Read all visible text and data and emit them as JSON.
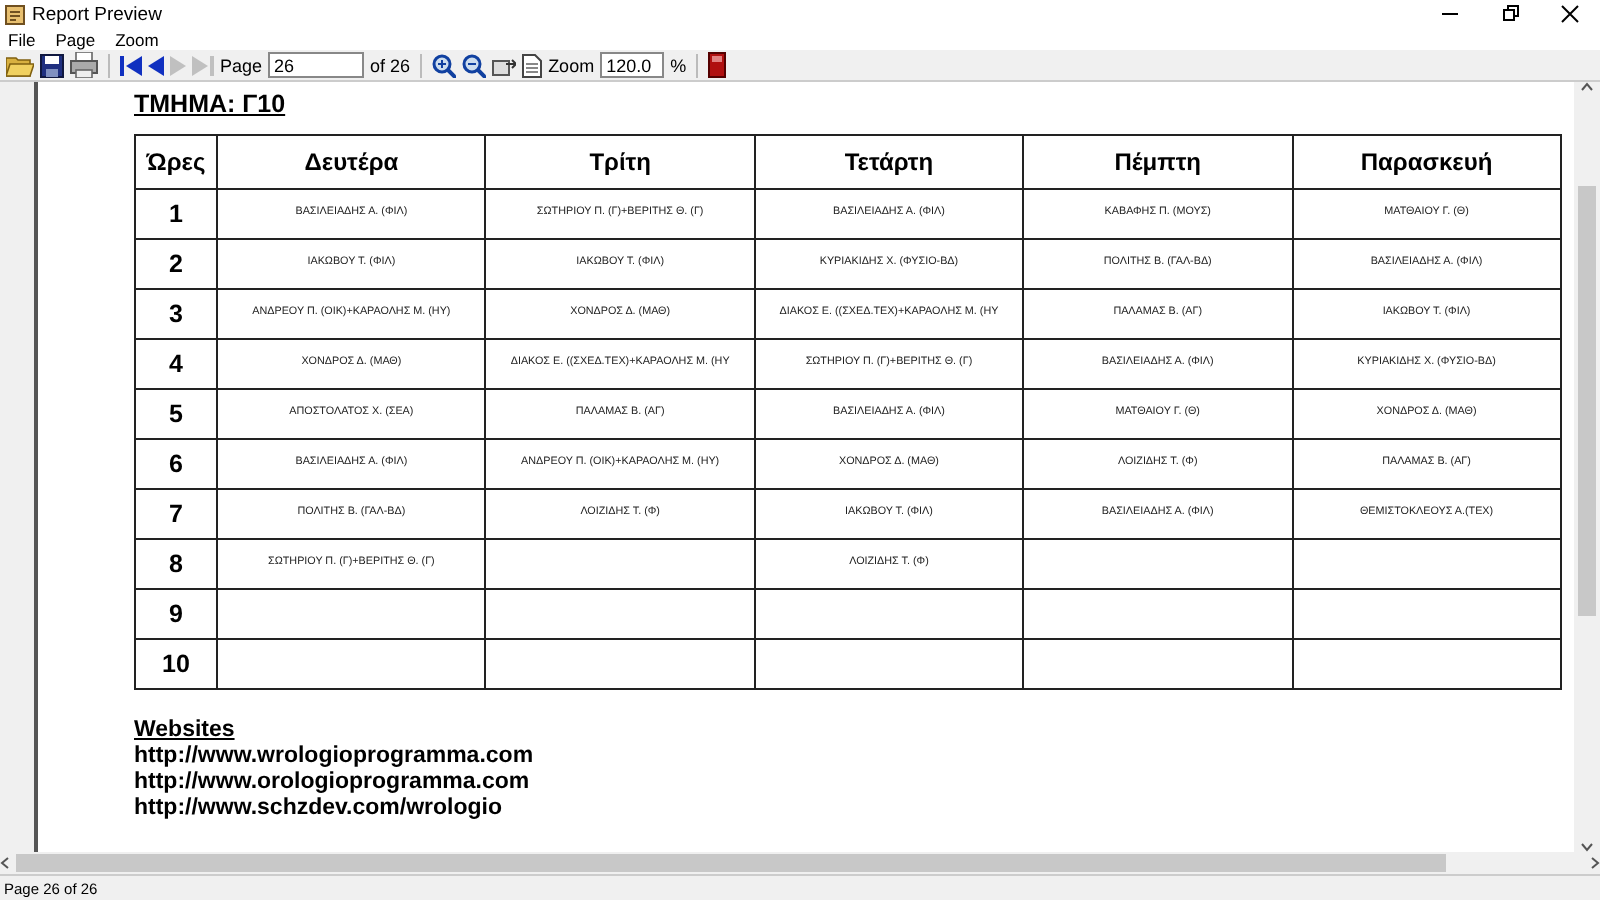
{
  "window": {
    "title": "Report Preview"
  },
  "menu": [
    "File",
    "Page",
    "Zoom"
  ],
  "toolbar": {
    "buttons": [
      {
        "kind": "open",
        "disabled": false
      },
      {
        "kind": "save",
        "disabled": false
      },
      {
        "kind": "print",
        "disabled": false
      },
      {
        "kind": "first",
        "disabled": false
      },
      {
        "kind": "prev",
        "disabled": false
      },
      {
        "kind": "next",
        "disabled": true
      },
      {
        "kind": "last",
        "disabled": true
      }
    ],
    "page_label": "Page",
    "page_value": "26",
    "page_of": "of 26",
    "zoom_buttons": [
      {
        "kind": "zoom_in"
      },
      {
        "kind": "zoom_out"
      },
      {
        "kind": "page_width"
      },
      {
        "kind": "whole_page"
      }
    ],
    "zoom_label": "Zoom",
    "zoom_value": "120.0",
    "zoom_unit": "%",
    "exit": {
      "kind": "exit"
    }
  },
  "report": {
    "heading": "ΤΜΗΜΑ: Γ10",
    "table": {
      "columns": [
        "Ώρες",
        "Δευτέρα",
        "Τρίτη",
        "Τετάρτη",
        "Πέμπτη",
        "Παρασκευή"
      ],
      "rows": [
        [
          "1",
          "ΒΑΣΙΛΕΙΑΔΗΣ Α. (ΦΙΛ)",
          "ΣΩΤΗΡΙΟΥ Π. (Γ)+ΒΕΡΙΤΗΣ Θ. (Γ)",
          "ΒΑΣΙΛΕΙΑΔΗΣ Α. (ΦΙΛ)",
          "ΚΑΒΑΦΗΣ Π. (ΜΟΥΣ)",
          "ΜΑΤΘΑΙΟΥ Γ. (Θ)"
        ],
        [
          "2",
          "ΙΑΚΩΒΟΥ Τ. (ΦΙΛ)",
          "ΙΑΚΩΒΟΥ Τ. (ΦΙΛ)",
          "ΚΥΡΙΑΚΙΔΗΣ Χ. (ΦΥΣΙΟ-ΒΔ)",
          "ΠΟΛΙΤΗΣ Β. (ΓΑΛ-ΒΔ)",
          "ΒΑΣΙΛΕΙΑΔΗΣ Α. (ΦΙΛ)"
        ],
        [
          "3",
          "ΑΝΔΡΕΟΥ Π. (ΟΙΚ)+ΚΑΡΑΟΛΗΣ Μ. (ΗΥ)",
          "ΧΟΝΔΡΟΣ Δ. (ΜΑΘ)",
          "ΔΙΑΚΟΣ Ε. ((ΣΧΕΔ.ΤΕΧ)+ΚΑΡΑΟΛΗΣ Μ. (ΗΥ",
          "ΠΑΛΑΜΑΣ Β. (ΑΓ)",
          "ΙΑΚΩΒΟΥ Τ. (ΦΙΛ)"
        ],
        [
          "4",
          "ΧΟΝΔΡΟΣ Δ. (ΜΑΘ)",
          "ΔΙΑΚΟΣ Ε. ((ΣΧΕΔ.ΤΕΧ)+ΚΑΡΑΟΛΗΣ Μ. (ΗΥ",
          "ΣΩΤΗΡΙΟΥ Π. (Γ)+ΒΕΡΙΤΗΣ Θ. (Γ)",
          "ΒΑΣΙΛΕΙΑΔΗΣ Α. (ΦΙΛ)",
          "ΚΥΡΙΑΚΙΔΗΣ Χ. (ΦΥΣΙΟ-ΒΔ)"
        ],
        [
          "5",
          "ΑΠΟΣΤΟΛΑΤΟΣ Χ. (ΣΕΑ)",
          "ΠΑΛΑΜΑΣ Β. (ΑΓ)",
          "ΒΑΣΙΛΕΙΑΔΗΣ Α. (ΦΙΛ)",
          "ΜΑΤΘΑΙΟΥ Γ. (Θ)",
          "ΧΟΝΔΡΟΣ Δ. (ΜΑΘ)"
        ],
        [
          "6",
          "ΒΑΣΙΛΕΙΑΔΗΣ Α. (ΦΙΛ)",
          "ΑΝΔΡΕΟΥ Π. (ΟΙΚ)+ΚΑΡΑΟΛΗΣ Μ. (ΗΥ)",
          "ΧΟΝΔΡΟΣ Δ. (ΜΑΘ)",
          "ΛΟΙΖΙΔΗΣ Τ. (Φ)",
          "ΠΑΛΑΜΑΣ Β. (ΑΓ)"
        ],
        [
          "7",
          "ΠΟΛΙΤΗΣ Β. (ΓΑΛ-ΒΔ)",
          "ΛΟΙΖΙΔΗΣ Τ. (Φ)",
          "ΙΑΚΩΒΟΥ Τ. (ΦΙΛ)",
          "ΒΑΣΙΛΕΙΑΔΗΣ Α. (ΦΙΛ)",
          "ΘΕΜΙΣΤΟΚΛΕΟΥΣ Α.(ΤΕΧ)"
        ],
        [
          "8",
          "ΣΩΤΗΡΙΟΥ Π. (Γ)+ΒΕΡΙΤΗΣ Θ. (Γ)",
          "",
          "ΛΟΙΖΙΔΗΣ Τ. (Φ)",
          "",
          ""
        ],
        [
          "9",
          "",
          "",
          "",
          "",
          ""
        ],
        [
          "10",
          "",
          "",
          "",
          "",
          ""
        ]
      ]
    },
    "websites_heading": "Websites",
    "websites": [
      "http://www.wrologioprogramma.com",
      "http://www.orologioprogramma.com",
      "http://www.schzdev.com/wrologio"
    ]
  },
  "status_bar": "Page 26 of 26"
}
